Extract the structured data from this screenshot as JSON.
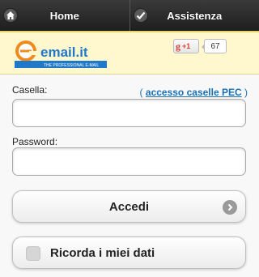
{
  "nav": {
    "home_label": "Home",
    "help_label": "Assistenza"
  },
  "banner": {
    "logo_text": "email.it",
    "logo_tagline": "THE PROFESSIONAL E-MAIL",
    "gplus_label": "+1",
    "gplus_count": "67"
  },
  "form": {
    "mailbox_label": "Casella:",
    "pec_link_prefix": "( ",
    "pec_link_text": "accesso caselle PEC",
    "pec_link_suffix": " )",
    "mailbox_value": "",
    "password_label": "Password:",
    "password_value": "",
    "submit_label": "Accedi",
    "remember_label": "Ricorda i miei dati",
    "remember_checked": false
  },
  "colors": {
    "navbar": "#2b2b2b",
    "banner_bg": "#fff8cf",
    "link": "#1a6fb5",
    "logo_blue": "#1f78c8",
    "logo_orange": "#f08a1c"
  }
}
